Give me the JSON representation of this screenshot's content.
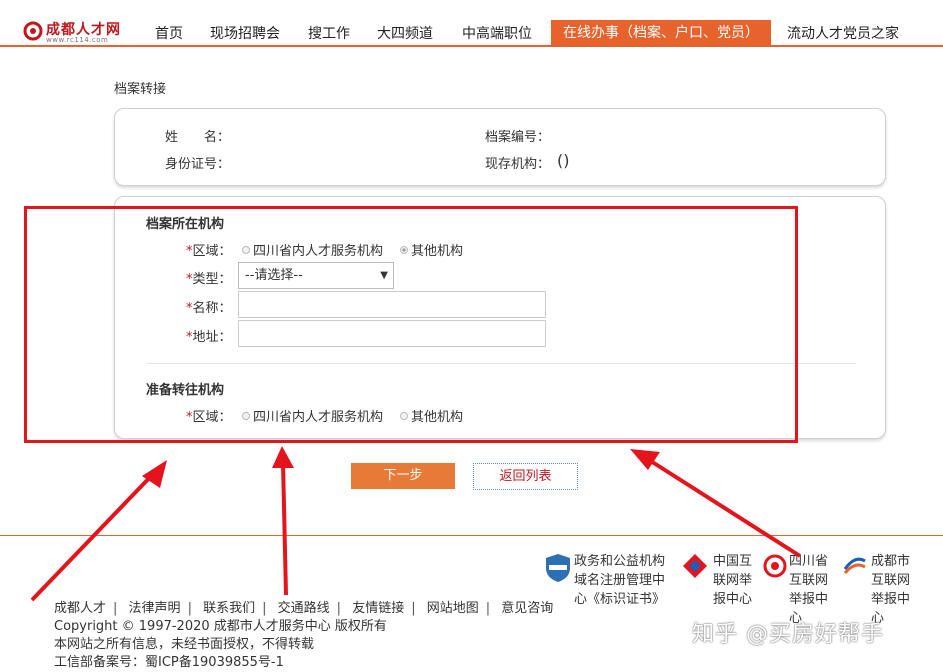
{
  "header": {
    "logo_text": "成都人才网",
    "logo_url": "www.rc114.com",
    "nav": [
      "首页",
      "现场招聘会",
      "搜工作",
      "大四频道",
      "中高端职位",
      "在线办事（档案、户口、党员）",
      "流动人才党员之家"
    ]
  },
  "page": {
    "section_title": "档案转接",
    "info": {
      "name_label": "姓　　名：",
      "id_label": "身份证号：",
      "file_no_label": "档案编号：",
      "current_org_label": "现存机构：",
      "current_org_value": "()"
    },
    "current_org": {
      "title": "档案所在机构",
      "region_label": "区域：",
      "region_option1": "四川省内人才服务机构",
      "region_option2": "其他机构",
      "type_label": "类型：",
      "type_value": "--请选择--",
      "name_label": "名称：",
      "address_label": "地址："
    },
    "target_org": {
      "title": "准备转往机构",
      "region_label": "区域：",
      "region_option1": "四川省内人才服务机构",
      "region_option2": "其他机构"
    },
    "required_mark": "*",
    "next_button": "下一步",
    "back_button": "返回列表"
  },
  "footer": {
    "links": [
      "成都人才",
      "法律声明",
      "联系我们",
      "交通路线",
      "友情链接",
      "网站地图",
      "意见咨询"
    ],
    "copyright": "Copyright © 1997-2020 成都市人才服务中心 版权所有",
    "notice": "本网站之所有信息，未经书面授权，不得转载",
    "icp": "工信部备案号：蜀ICP备19039855号-1",
    "badges": [
      {
        "lines": [
          "政务和公益机构",
          "域名注册管理中",
          "心《标识证书》"
        ]
      },
      {
        "lines": [
          "中国互",
          "联网举",
          "报中心"
        ]
      },
      {
        "lines": [
          "四川省",
          "互联网",
          "举报中",
          "心"
        ]
      },
      {
        "lines": [
          "成都市",
          "互联网",
          "举报中",
          "心"
        ]
      }
    ]
  },
  "watermark": "知乎 @买房好帮手",
  "colors": {
    "brand_orange": "#e8622c",
    "brand_red": "#c0161c",
    "annotation_red": "#e3141b"
  }
}
